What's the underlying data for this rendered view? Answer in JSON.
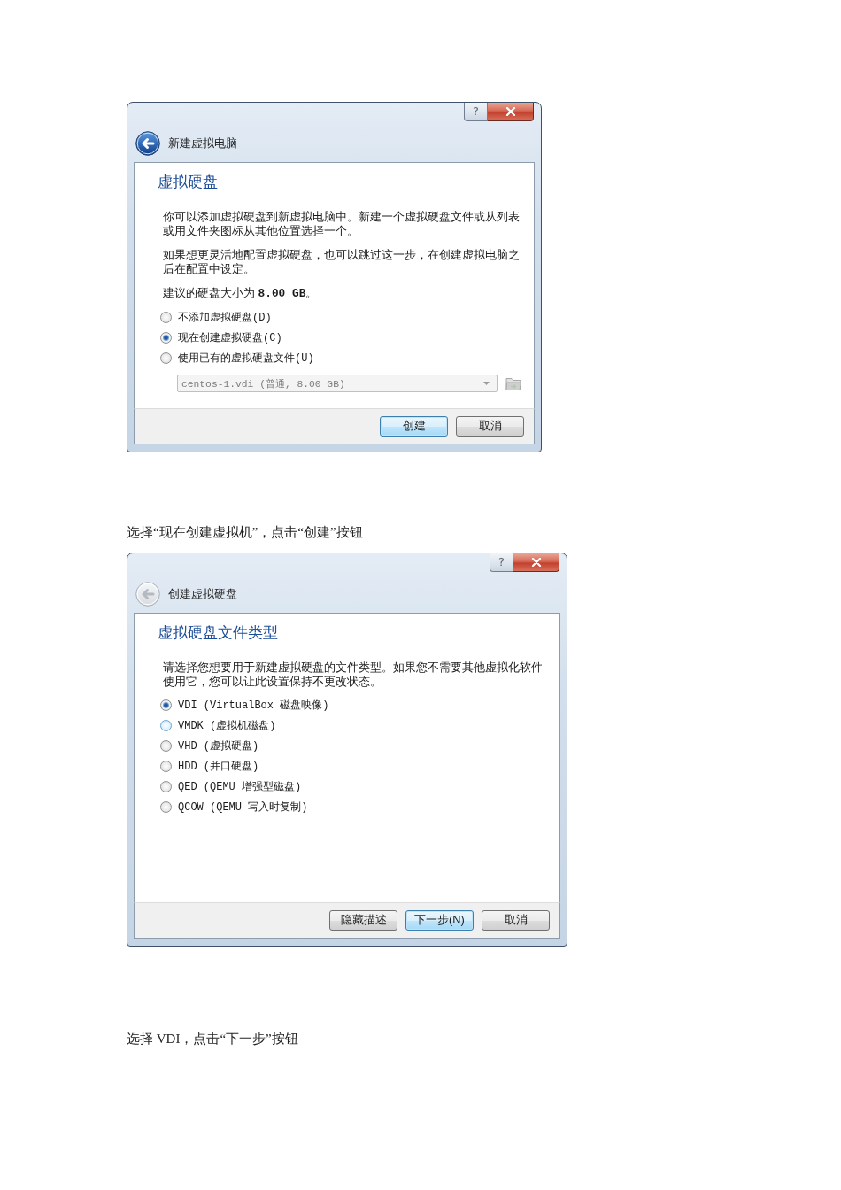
{
  "steps": [
    {
      "dialog": {
        "window_buttons": {
          "help": "?"
        },
        "back_disabled": false,
        "nav_title": "新建虚拟电脑",
        "heading": "虚拟硬盘",
        "paragraphs": [
          "你可以添加虚拟硬盘到新虚拟电脑中。新建一个虚拟硬盘文件或从列表或用文件夹图标从其他位置选择一个。",
          "如果想更灵活地配置虚拟硬盘，也可以跳过这一步，在创建虚拟电脑之后在配置中设定。",
          "建议的硬盘大小为 **8.00 GB**。"
        ],
        "options": [
          {
            "label": "不添加虚拟硬盘(D)",
            "selected": false,
            "hovered": false
          },
          {
            "label": "现在创建虚拟硬盘(C)",
            "selected": true,
            "hovered": false
          },
          {
            "label": "使用已有的虚拟硬盘文件(U)",
            "selected": false,
            "hovered": false
          }
        ],
        "dropdown": {
          "value": "centos-1.vdi (普通, 8.00 GB)",
          "disabled": true
        },
        "buttons": [
          {
            "label": "创建",
            "default": true
          },
          {
            "label": "取消",
            "default": false
          }
        ]
      },
      "caption": "选择“现在创建虚拟机”，点击“创建”按钮"
    },
    {
      "dialog": {
        "window_buttons": {
          "help": "?"
        },
        "back_disabled": true,
        "nav_title": "创建虚拟硬盘",
        "heading": "虚拟硬盘文件类型",
        "paragraphs": [
          "请选择您想要用于新建虚拟硬盘的文件类型。如果您不需要其他虚拟化软件使用它，您可以让此设置保持不更改状态。"
        ],
        "options": [
          {
            "label": "VDI (VirtualBox 磁盘映像)",
            "selected": true,
            "hovered": false
          },
          {
            "label": "VMDK (虚拟机磁盘)",
            "selected": false,
            "hovered": true
          },
          {
            "label": "VHD (虚拟硬盘)",
            "selected": false,
            "hovered": false
          },
          {
            "label": "HDD (并口硬盘)",
            "selected": false,
            "hovered": false
          },
          {
            "label": "QED (QEMU 增强型磁盘)",
            "selected": false,
            "hovered": false
          },
          {
            "label": "QCOW (QEMU 写入时复制)",
            "selected": false,
            "hovered": false
          }
        ],
        "buttons": [
          {
            "label": "隐藏描述",
            "default": false
          },
          {
            "label": "下一步(N)",
            "default": true
          },
          {
            "label": "取消",
            "default": false
          }
        ]
      },
      "caption": "选择 VDI，点击“下一步”按钮"
    }
  ]
}
